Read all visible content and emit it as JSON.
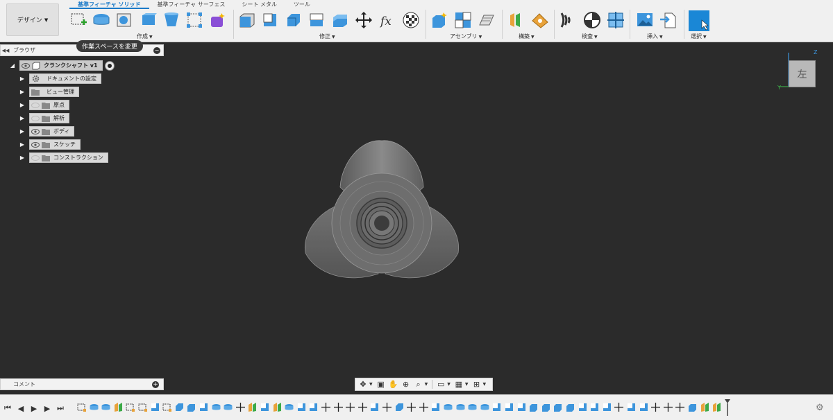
{
  "toolbar": {
    "workspace_button": "デザイン",
    "tabs": [
      "基準フィーチャ ソリッド",
      "基準フィーチャ サーフェス",
      "シート メタル",
      "ツール"
    ],
    "groups": [
      "作成",
      "修正",
      "アセンブリ",
      "構築",
      "検査",
      "挿入",
      "選択"
    ]
  },
  "tooltip": "作業スペースを変更",
  "browser": {
    "title": "ブラウザ",
    "root": "クランクシャフト v1",
    "items": [
      "ドキュメントの設定",
      "ビュー管理",
      "原点",
      "解析",
      "ボディ",
      "スケッチ",
      "コンストラクション"
    ]
  },
  "viewcube": {
    "face_label": "左",
    "axis_z": "Z",
    "axis_y": "Y"
  },
  "comments": {
    "label": "コメント"
  },
  "colors": {
    "accent": "#1a7ac8",
    "canvas": "#2b2b2b",
    "icon_blue": "#3d95dc"
  }
}
